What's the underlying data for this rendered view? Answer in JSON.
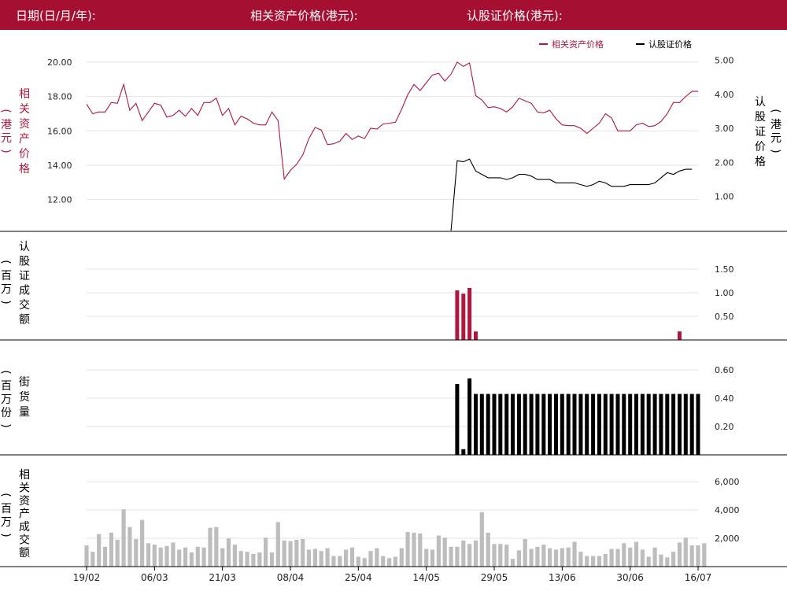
{
  "header": {
    "date_label": "日期(日/月/年):",
    "asset_price_label": "相关资产价格(港元):",
    "warrant_price_label": "认股证价格(港元):"
  },
  "colors": {
    "brand": "#a50f32",
    "asset_line": "#b0173e",
    "warrant_line": "#000000",
    "volume_bar": "#b0173e",
    "outstanding_bar": "#000000",
    "asset_turnover_bar": "#bdbdbd"
  },
  "chart_data": [
    {
      "type": "line",
      "title": "",
      "legend": [
        "相关资产价格",
        "认股证价格"
      ],
      "legend_placement": "top-right",
      "ylabel_left": "相关资产价格（港元）",
      "ylabel_right": "认股证价格（港元）",
      "ylim_left": [
        10.2,
        20.5
      ],
      "yticks_left": [
        "12.00",
        "14.00",
        "16.00",
        "18.00",
        "20.00"
      ],
      "ylim_right": [
        0,
        5.2
      ],
      "yticks_right": [
        "1.00",
        "2.00",
        "3.00",
        "4.00",
        "5.00"
      ],
      "grid": true,
      "series": [
        {
          "name": "相关资产价格",
          "axis": "left",
          "values": [
            17.55,
            17.0,
            17.1,
            17.1,
            17.65,
            17.6,
            18.7,
            17.2,
            17.6,
            16.6,
            17.1,
            17.6,
            17.5,
            16.8,
            16.9,
            17.2,
            16.85,
            17.3,
            16.9,
            17.65,
            17.65,
            17.9,
            16.9,
            17.3,
            16.35,
            16.85,
            16.7,
            16.45,
            16.35,
            16.35,
            17.1,
            16.6,
            13.2,
            13.7,
            14.05,
            14.6,
            15.55,
            16.2,
            16.05,
            15.2,
            15.25,
            15.4,
            15.85,
            15.5,
            15.7,
            15.55,
            16.15,
            16.1,
            16.4,
            16.45,
            16.5,
            17.25,
            18.1,
            18.7,
            18.35,
            18.8,
            19.25,
            19.35,
            18.9,
            19.3,
            20.0,
            19.75,
            19.95,
            18.05,
            17.8,
            17.35,
            17.4,
            17.3,
            17.1,
            17.4,
            17.9,
            17.75,
            17.6,
            17.1,
            17.05,
            17.2,
            16.7,
            16.35,
            16.3,
            16.3,
            16.15,
            15.85,
            16.15,
            16.45,
            17.0,
            16.75,
            16.0,
            16.0,
            16.0,
            16.35,
            16.45,
            16.25,
            16.3,
            16.55,
            17.0,
            17.65,
            17.65,
            18.0,
            18.3,
            18.3
          ]
        },
        {
          "name": "认股证价格",
          "axis": "right",
          "start_index": 59,
          "values": [
            0,
            2.05,
            2.02,
            2.1,
            1.75,
            1.65,
            1.55,
            1.55,
            1.55,
            1.5,
            1.55,
            1.65,
            1.65,
            1.6,
            1.5,
            1.5,
            1.5,
            1.4,
            1.4,
            1.4,
            1.4,
            1.35,
            1.3,
            1.35,
            1.45,
            1.4,
            1.3,
            1.3,
            1.3,
            1.35,
            1.35,
            1.35,
            1.35,
            1.4,
            1.55,
            1.7,
            1.65,
            1.75,
            1.8,
            1.8
          ]
        }
      ]
    },
    {
      "type": "bar",
      "ylabel_left": "认股证成交额（百万）",
      "ylim": [
        0,
        1.8
      ],
      "yticks": [
        "0.50",
        "1.00",
        "1.50"
      ],
      "grid": true,
      "points": [
        [
          60,
          1.05
        ],
        [
          61,
          0.98
        ],
        [
          62,
          1.1
        ],
        [
          63,
          0.18
        ],
        [
          96,
          0.18
        ]
      ]
    },
    {
      "type": "bar",
      "ylabel_left": "街货量（百万份）",
      "ylim": [
        0,
        0.7
      ],
      "yticks": [
        "0.20",
        "0.40",
        "0.60"
      ],
      "grid": true,
      "start_index": 60,
      "values": [
        0.5,
        0.04,
        0.54,
        0.43,
        0.43,
        0.43,
        0.43,
        0.43,
        0.43,
        0.43,
        0.43,
        0.43,
        0.43,
        0.43,
        0.43,
        0.43,
        0.43,
        0.43,
        0.43,
        0.43,
        0.43,
        0.43,
        0.43,
        0.43,
        0.43,
        0.43,
        0.43,
        0.43,
        0.43,
        0.43,
        0.43,
        0.43,
        0.43,
        0.43,
        0.43,
        0.43,
        0.43,
        0.43,
        0.43,
        0.43
      ]
    },
    {
      "type": "bar",
      "ylabel_left": "相关资产成交额（百万）",
      "ylim": [
        0,
        7400
      ],
      "yticks": [
        "2,000",
        "4,000",
        "6,000"
      ],
      "grid": true,
      "categories_shown": [
        "19/02",
        "06/03",
        "21/03",
        "08/04",
        "25/04",
        "14/05",
        "29/05",
        "13/06",
        "30/06",
        "16/07"
      ],
      "values": [
        1500,
        1050,
        2300,
        1400,
        2400,
        1900,
        4050,
        2800,
        1950,
        3300,
        1650,
        1550,
        1350,
        1450,
        1700,
        1200,
        1350,
        1000,
        1400,
        1350,
        2750,
        2800,
        1300,
        2000,
        1550,
        1100,
        1050,
        900,
        1000,
        2050,
        1000,
        3150,
        1850,
        1800,
        1900,
        1950,
        1200,
        1250,
        1100,
        1300,
        750,
        750,
        1200,
        1350,
        700,
        600,
        1100,
        1300,
        750,
        600,
        700,
        1300,
        2450,
        2400,
        2350,
        1250,
        1200,
        2200,
        2050,
        1400,
        1400,
        1850,
        1600,
        1850,
        3850,
        2400,
        1600,
        1600,
        1550,
        550,
        1150,
        1950,
        1250,
        1400,
        1550,
        1300,
        1200,
        1300,
        1350,
        1750,
        1050,
        750,
        750,
        750,
        900,
        1250,
        1250,
        1650,
        1350,
        1750,
        1200,
        700,
        1350,
        850,
        650,
        1050,
        1700,
        2050,
        1500,
        1500,
        1650
      ]
    }
  ]
}
